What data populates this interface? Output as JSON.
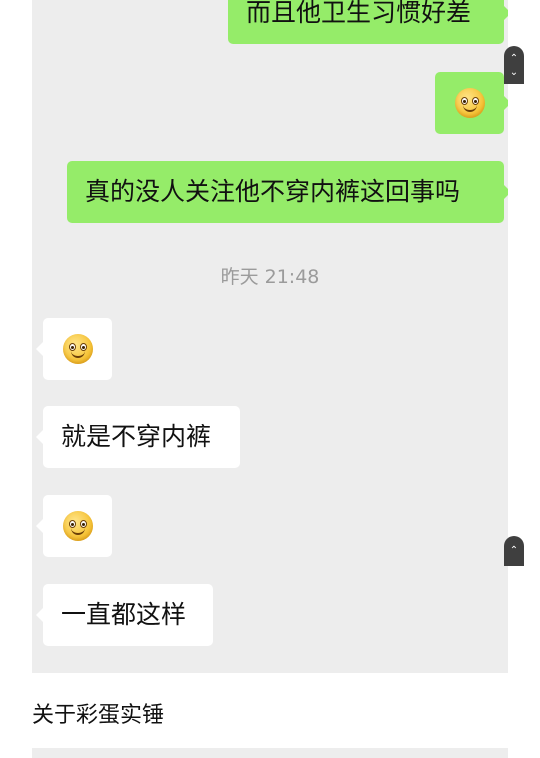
{
  "chat": {
    "messages": [
      {
        "side": "out",
        "type": "text",
        "text": "而且他卫生习惯好差"
      },
      {
        "side": "out",
        "type": "emoji",
        "emoji": "smile-emoji"
      },
      {
        "side": "out",
        "type": "text",
        "text": "真的没人关注他不穿内裤这回事吗"
      },
      {
        "side": "in",
        "type": "emoji",
        "emoji": "smile-emoji"
      },
      {
        "side": "in",
        "type": "text",
        "text": "就是不穿内裤"
      },
      {
        "side": "in",
        "type": "emoji",
        "emoji": "smile-emoji"
      },
      {
        "side": "in",
        "type": "text",
        "text": "一直都这样"
      }
    ],
    "timestamp": "昨天 21:48",
    "colors": {
      "outgoing_bubble": "#95ec69",
      "incoming_bubble": "#ffffff",
      "chat_background": "#ededed",
      "timestamp_text": "#9b9b9b"
    }
  },
  "controls": {
    "scroll_up_glyph": "⌃",
    "scroll_down_glyph": "⌄"
  },
  "caption": "关于彩蛋实锤"
}
